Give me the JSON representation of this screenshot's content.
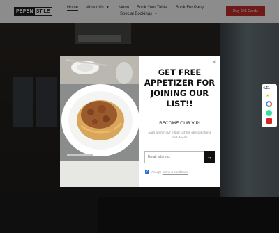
{
  "header": {
    "logo_dark": "PEPEN",
    "logo_light": "STILE",
    "nav": {
      "home": "Home",
      "about": "About Us",
      "menu": "Menu",
      "book_table": "Book Your Table",
      "book_party": "Book For Party",
      "special": "Special Bookings"
    },
    "gift_button": "Buy Gift Cards"
  },
  "side_widget": {
    "rating": "4.61",
    "stars": "★"
  },
  "modal": {
    "headline": "GET FREE APPETIZER FOR JOINING OUR LIST!!",
    "subheading": "BECOME OUR VIP!",
    "description": "Sign up for our email list for special offers and deals!",
    "email_placeholder": "Email address",
    "submit_arrow": "→",
    "terms_prefix": "Accept",
    "terms_link": "terms & conditions",
    "close": "×"
  },
  "colors": {
    "accent": "#c9302c",
    "checkbox": "#2a6fd6"
  }
}
